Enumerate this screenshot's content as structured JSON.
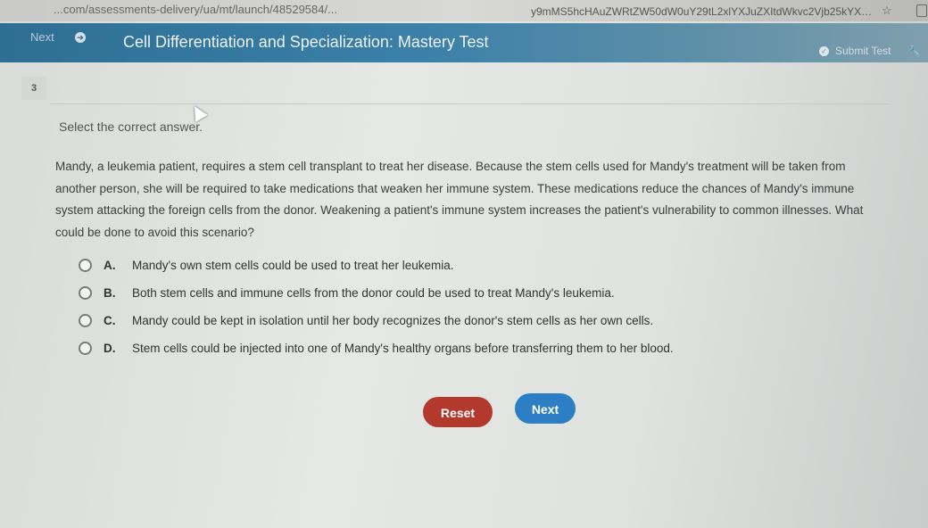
{
  "browser": {
    "url_left": "...com/assessments-delivery/ua/mt/launch/48529584/...",
    "url_right": "y9mMS5hcHAuZWRtZW50dW0uY29tL2xlYXJuZXItdWkvc2Vjb25kYXJ5L...",
    "star_icon": "☆"
  },
  "topbar": {
    "next_label": "Next",
    "title": "Cell Differentiation and Specialization: Mastery Test",
    "submit_label": "Submit Test",
    "colors": {
      "bar": "#3a80a8"
    }
  },
  "question": {
    "number": "3",
    "prompt": "Select the correct answer.",
    "passage": "Mandy, a leukemia patient, requires a stem cell transplant to treat her disease. Because the stem cells used for Mandy's treatment will be taken from another person, she will be required to take medications that weaken her immune system. These medications reduce the chances of Mandy's immune system attacking the foreign cells from the donor. Weakening a patient's immune system increases the patient's vulnerability to common illnesses. What could be done to avoid this scenario?",
    "options": [
      {
        "letter": "A.",
        "text": "Mandy's own stem cells could be used to treat her leukemia."
      },
      {
        "letter": "B.",
        "text": "Both stem cells and immune cells from the donor could be used to treat Mandy's leukemia."
      },
      {
        "letter": "C.",
        "text": "Mandy could be kept in isolation until her body recognizes the donor's stem cells as her own cells."
      },
      {
        "letter": "D.",
        "text": "Stem cells could be injected into one of Mandy's healthy organs before transferring them to her blood."
      }
    ]
  },
  "buttons": {
    "reset_label": "Reset",
    "next_label": "Next",
    "colors": {
      "reset": "#b2392b",
      "next": "#2c7fc4"
    }
  }
}
